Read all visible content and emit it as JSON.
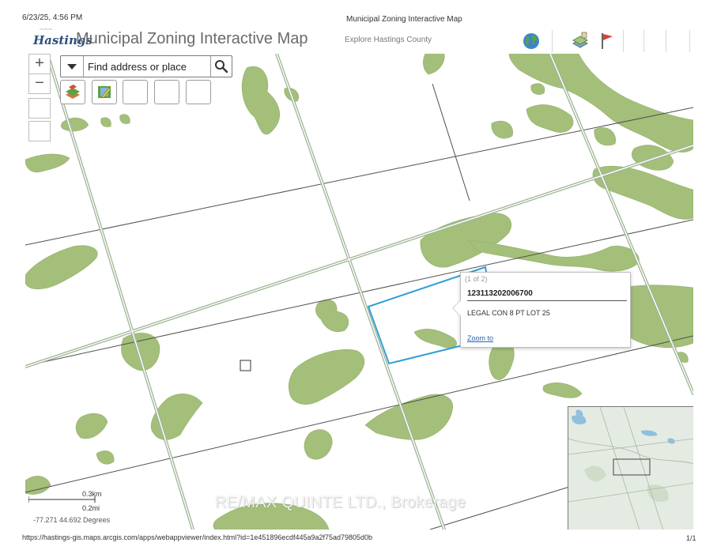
{
  "print": {
    "date": "6/23/25, 4:56 PM",
    "title": "Municipal Zoning Interactive Map",
    "url": "https://hastings-gis.maps.arcgis.com/apps/webappviewer/index.html?id=1e451896ecdf445a9a2f75ad79805d0b",
    "page": "1/1"
  },
  "header": {
    "logo_text": "Hastings",
    "title": "Municipal Zoning Interactive Map",
    "subtitle": "Explore Hastings County",
    "icons": [
      "globe-icon",
      "layer-list-icon",
      "bookmark-flag-icon"
    ]
  },
  "map_controls": {
    "zoom_in": "+",
    "zoom_out": "−"
  },
  "search": {
    "placeholder": "Find address or place"
  },
  "popup": {
    "count": "(1 of 2)",
    "parcel_id": "123113202006700",
    "legal": "LEGAL  CON 8 PT LOT 25",
    "zoom_link": "Zoom to"
  },
  "scale": {
    "km": "0.3km",
    "mi": "0.2mi"
  },
  "coordinates": "-77.271 44.692 Degrees",
  "watermark": "RE/MAX QUINTE LTD., Brokerage",
  "colors": {
    "vegetation": "#a3bf7a",
    "road": "#9fb596",
    "parcel_line": "#555555",
    "selection": "#2f9fd6",
    "link": "#2a63b0"
  }
}
